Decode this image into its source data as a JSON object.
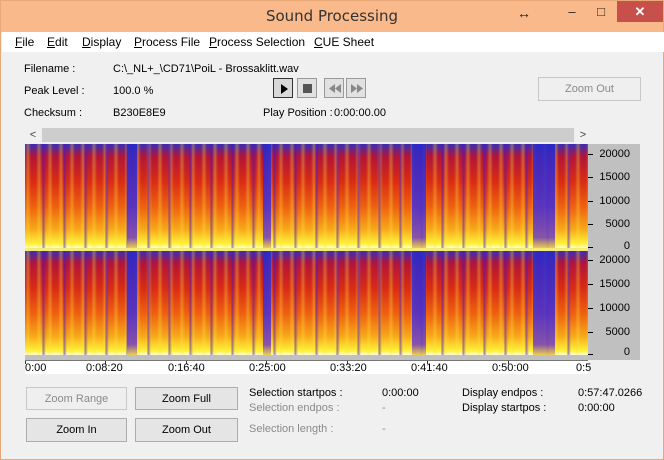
{
  "window": {
    "title": "Sound Processing",
    "resize_glyph": "↔",
    "minimize_glyph": "–",
    "maximize_glyph": "□",
    "close_glyph": "✕"
  },
  "menu": [
    "File",
    "Edit",
    "Display",
    "Process File",
    "Process Selection",
    "CUE Sheet"
  ],
  "info": {
    "filename_label": "Filename :",
    "filename_value": "C:\\_NL+_\\CD71\\PoiL - Brossaklitt.wav",
    "peak_label": "Peak Level :",
    "peak_value": "100.0 %",
    "checksum_label": "Checksum :",
    "checksum_value": "B230E8E9",
    "play_position_label": "Play Position :",
    "play_position_value": "0:00:00.00"
  },
  "transport": {
    "play_icon": "play-icon",
    "stop_icon": "stop-icon",
    "rewind_icon": "rewind-icon",
    "forward_icon": "fast-forward-icon"
  },
  "zoom_out_top_label": "Zoom Out",
  "scroll": {
    "left_glyph": "<",
    "right_glyph": ">"
  },
  "spectrogram": {
    "freq_labels": [
      "20000",
      "15000",
      "10000",
      "5000",
      "0"
    ],
    "time_labels": [
      "0:00",
      "0:08:20",
      "0:16:40",
      "0:25:00",
      "0:33:20",
      "0:41:40",
      "0:50:00",
      "0:5"
    ],
    "colors": {
      "low": "#3b2db5",
      "mid": "#d82a15",
      "high": "#fff23a"
    }
  },
  "buttons": {
    "zoom_range": "Zoom Range",
    "zoom_full": "Zoom Full",
    "zoom_in": "Zoom In",
    "zoom_out": "Zoom Out"
  },
  "selection": {
    "startpos_label": "Selection startpos :",
    "startpos_value": "0:00:00",
    "endpos_label": "Selection endpos :",
    "endpos_value": "-",
    "length_label": "Selection length :",
    "length_value": "-"
  },
  "display": {
    "endpos_label": "Display endpos :",
    "endpos_value": "0:57:47.0266",
    "startpos_label": "Display startpos :",
    "startpos_value": "0:00:00"
  }
}
